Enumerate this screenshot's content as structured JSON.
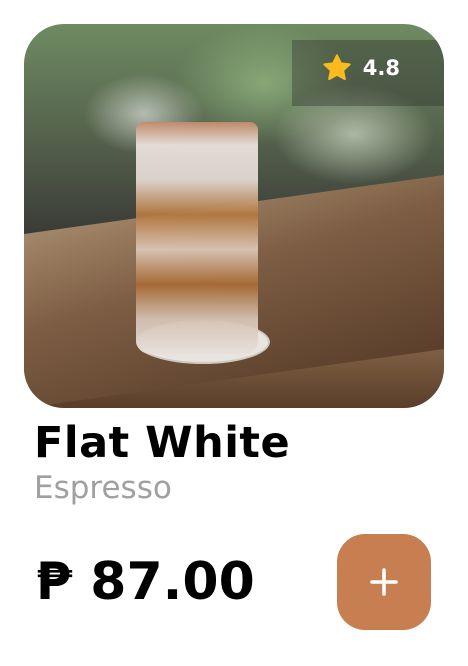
{
  "product": {
    "name": "Flat White",
    "category": "Espresso",
    "price": "₱ 87.00",
    "rating": "4.8",
    "rating_icon": "star-icon",
    "add_icon": "plus-icon"
  },
  "colors": {
    "accent": "#C77E50",
    "star": "#FBBA1E",
    "subtitle": "#A0A0A0"
  }
}
